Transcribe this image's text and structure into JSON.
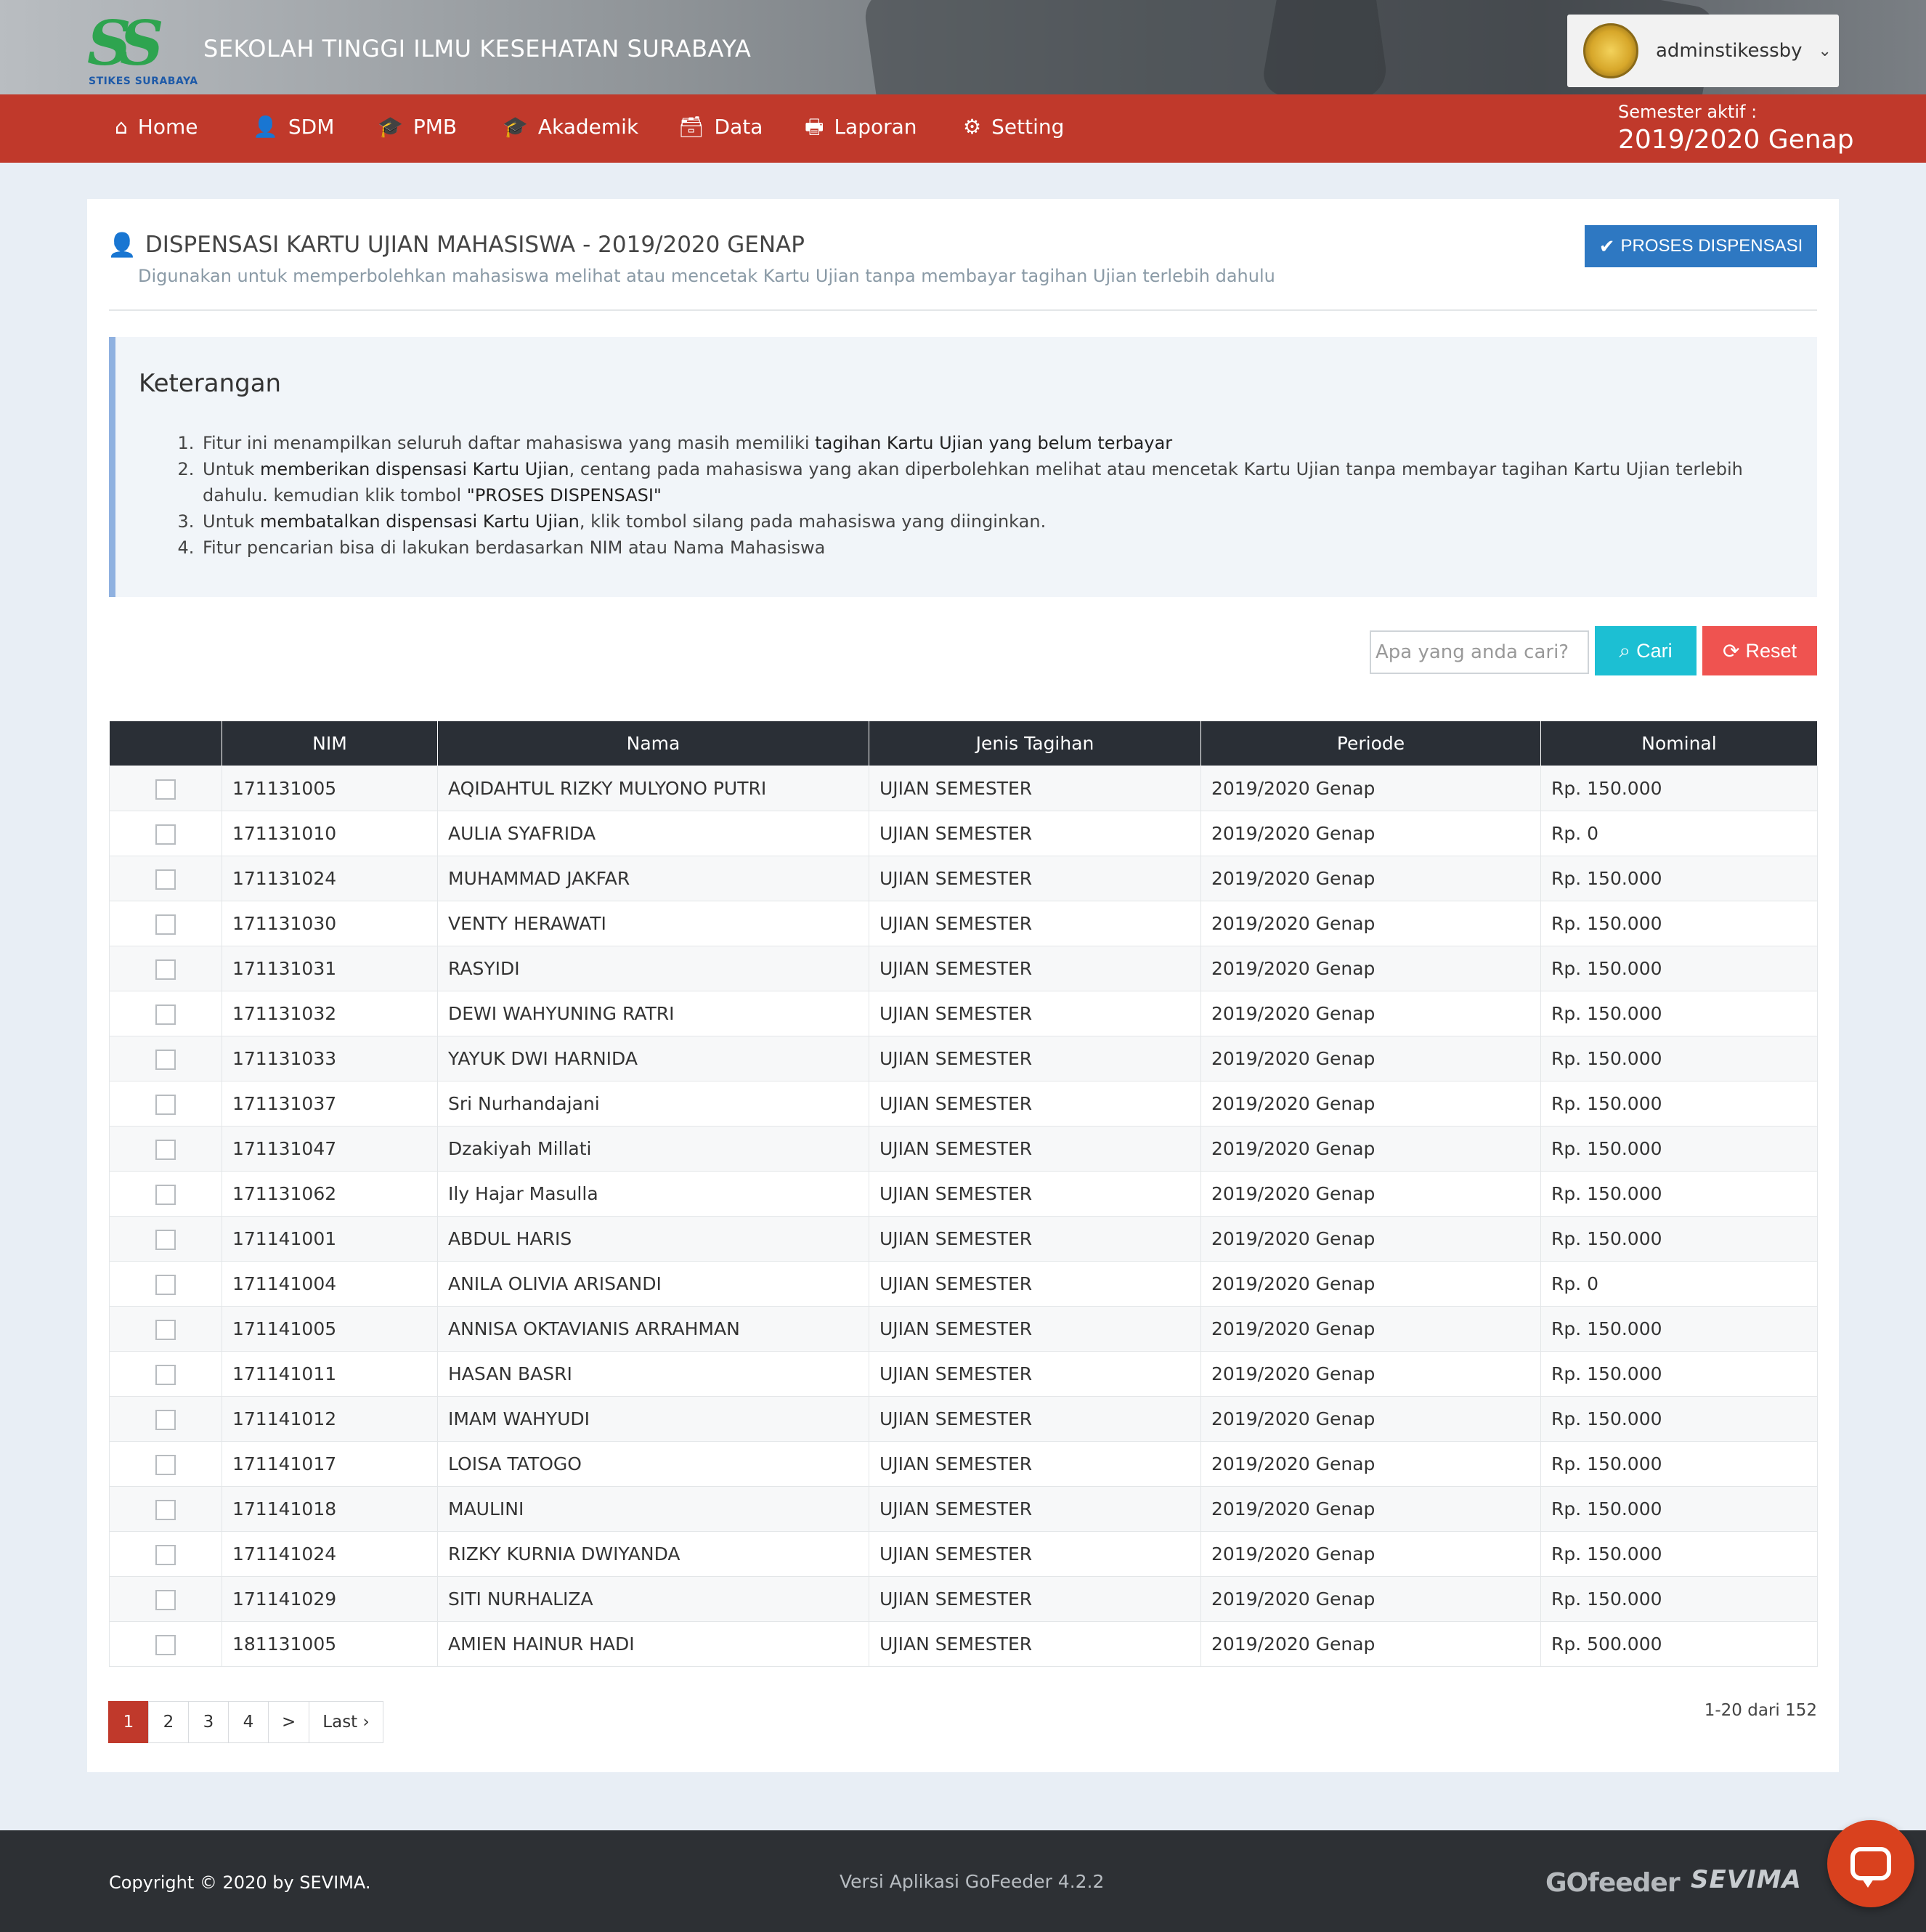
{
  "header": {
    "logo_text": "SS",
    "logo_sub": "STIKES SURABAYA",
    "school_name": "SEKOLAH TINGGI ILMU KESEHATAN SURABAYA",
    "username": "adminstikessby",
    "chevron": "⌄"
  },
  "nav": {
    "items": [
      {
        "label": "Home",
        "icon": "home-icon",
        "glyph": "⌂"
      },
      {
        "label": "SDM",
        "icon": "user-icon",
        "glyph": "👤"
      },
      {
        "label": "PMB",
        "icon": "graduation-cap-icon",
        "glyph": "🎓"
      },
      {
        "label": "Akademik",
        "icon": "graduation-cap-icon",
        "glyph": "🎓"
      },
      {
        "label": "Data",
        "icon": "inbox-icon",
        "glyph": "🗃"
      },
      {
        "label": "Laporan",
        "icon": "printer-icon",
        "glyph": "🖶"
      },
      {
        "label": "Setting",
        "icon": "gear-icon",
        "glyph": "⚙"
      }
    ],
    "semester_label": "Semester aktif :",
    "semester_value": "2019/2020 Genap"
  },
  "page": {
    "title": "DISPENSASI KARTU UJIAN MAHASISWA - 2019/2020 GENAP",
    "subtitle": "Digunakan untuk memperbolehkan mahasiswa melihat atau mencetak Kartu Ujian tanpa membayar tagihan Ujian terlebih dahulu",
    "proses_button": "PROSES DISPENSASI"
  },
  "info": {
    "heading": "Keterangan",
    "items": [
      {
        "a": "Fitur ini menampilkan seluruh daftar mahasiswa yang masih memiliki ",
        "b": "tagihan Kartu Ujian yang belum terbayar",
        "c": ""
      },
      {
        "a": "Untuk ",
        "b": "memberikan dispensasi Kartu Ujian",
        "c": ", centang pada mahasiswa yang akan diperbolehkan melihat atau mencetak Kartu Ujian tanpa membayar tagihan Kartu Ujian terlebih dahulu. kemudian klik tombol ",
        "d": "\"PROSES DISPENSASI\""
      },
      {
        "a": "Untuk ",
        "b": "membatalkan dispensasi Kartu Ujian",
        "c": ", klik tombol silang pada mahasiswa yang diinginkan."
      },
      {
        "a": "Fitur pencarian bisa di lakukan berdasarkan NIM atau Nama Mahasiswa",
        "b": "",
        "c": ""
      }
    ]
  },
  "search": {
    "placeholder": "Apa yang anda cari?",
    "cari_label": "Cari",
    "reset_label": "Reset"
  },
  "table": {
    "headers": [
      "",
      "NIM",
      "Nama",
      "Jenis Tagihan",
      "Periode",
      "Nominal"
    ],
    "rows": [
      [
        "171131005",
        "AQIDAHTUL RIZKY MULYONO PUTRI",
        "UJIAN SEMESTER",
        "2019/2020 Genap",
        "Rp. 150.000"
      ],
      [
        "171131010",
        "AULIA SYAFRIDA",
        "UJIAN SEMESTER",
        "2019/2020 Genap",
        "Rp. 0"
      ],
      [
        "171131024",
        "MUHAMMAD JAKFAR",
        "UJIAN SEMESTER",
        "2019/2020 Genap",
        "Rp. 150.000"
      ],
      [
        "171131030",
        "VENTY HERAWATI",
        "UJIAN SEMESTER",
        "2019/2020 Genap",
        "Rp. 150.000"
      ],
      [
        "171131031",
        "RASYIDI",
        "UJIAN SEMESTER",
        "2019/2020 Genap",
        "Rp. 150.000"
      ],
      [
        "171131032",
        "DEWI WAHYUNING RATRI",
        "UJIAN SEMESTER",
        "2019/2020 Genap",
        "Rp. 150.000"
      ],
      [
        "171131033",
        "YAYUK DWI HARNIDA",
        "UJIAN SEMESTER",
        "2019/2020 Genap",
        "Rp. 150.000"
      ],
      [
        "171131037",
        "Sri Nurhandajani",
        "UJIAN SEMESTER",
        "2019/2020 Genap",
        "Rp. 150.000"
      ],
      [
        "171131047",
        "Dzakiyah Millati",
        "UJIAN SEMESTER",
        "2019/2020 Genap",
        "Rp. 150.000"
      ],
      [
        "171131062",
        "Ily Hajar Masulla",
        "UJIAN SEMESTER",
        "2019/2020 Genap",
        "Rp. 150.000"
      ],
      [
        "171141001",
        "ABDUL HARIS",
        "UJIAN SEMESTER",
        "2019/2020 Genap",
        "Rp. 150.000"
      ],
      [
        "171141004",
        "ANILA OLIVIA ARISANDI",
        "UJIAN SEMESTER",
        "2019/2020 Genap",
        "Rp. 0"
      ],
      [
        "171141005",
        "ANNISA OKTAVIANIS ARRAHMAN",
        "UJIAN SEMESTER",
        "2019/2020 Genap",
        "Rp. 150.000"
      ],
      [
        "171141011",
        "HASAN BASRI",
        "UJIAN SEMESTER",
        "2019/2020 Genap",
        "Rp. 150.000"
      ],
      [
        "171141012",
        "IMAM WAHYUDI",
        "UJIAN SEMESTER",
        "2019/2020 Genap",
        "Rp. 150.000"
      ],
      [
        "171141017",
        "LOISA TATOGO",
        "UJIAN SEMESTER",
        "2019/2020 Genap",
        "Rp. 150.000"
      ],
      [
        "171141018",
        "MAULINI",
        "UJIAN SEMESTER",
        "2019/2020 Genap",
        "Rp. 150.000"
      ],
      [
        "171141024",
        "RIZKY KURNIA DWIYANDA",
        "UJIAN SEMESTER",
        "2019/2020 Genap",
        "Rp. 150.000"
      ],
      [
        "171141029",
        "SITI NURHALIZA",
        "UJIAN SEMESTER",
        "2019/2020 Genap",
        "Rp. 150.000"
      ],
      [
        "181131005",
        "AMIEN HAINUR HADI",
        "UJIAN SEMESTER",
        "2019/2020 Genap",
        "Rp. 500.000"
      ]
    ]
  },
  "pagination": {
    "pages": [
      "1",
      "2",
      "3",
      "4",
      ">",
      "Last ›"
    ],
    "active": "1",
    "count_text": "1-20 dari 152"
  },
  "footer": {
    "copyright": "Copyright © 2020 by SEVIMA.",
    "version": "Versi Aplikasi GoFeeder 4.2.2",
    "gofeeder_logo": "GOfeeder",
    "sevima_logo": "SEVIMA"
  },
  "colors": {
    "nav_red": "#c0392b",
    "primary_blue": "#2e78c2",
    "info_cyan": "#1cbfd3",
    "danger_red": "#ef5350",
    "table_header": "#2a2f36",
    "footer_bg": "#2d3034"
  }
}
